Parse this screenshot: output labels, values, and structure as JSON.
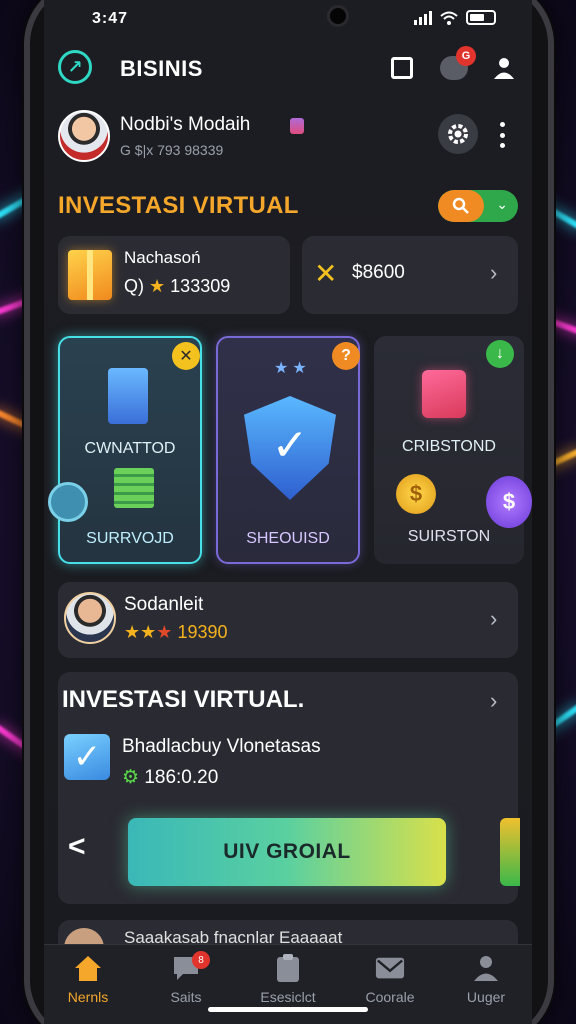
{
  "status_bar": {
    "time": "3:47"
  },
  "header": {
    "title": "BISINIS",
    "notification_count": "G"
  },
  "profile": {
    "name": "Nodbi's Modaih",
    "subtitle": "G $|x  793 98339"
  },
  "section1": {
    "title": "INVESTASI VIRTUAL"
  },
  "summary_cards": [
    {
      "title": "Nachasoń",
      "sub_prefix": "Q)",
      "value": "133309"
    },
    {
      "amount": "$8600"
    }
  ],
  "features": [
    {
      "label1": "CWNATTOD",
      "label2": "SURRVOJD",
      "badge": "✕",
      "badge_color": "#f4c21e"
    },
    {
      "label1": "",
      "label2": "SHEOUISD",
      "badge": "?",
      "badge_color": "#f08a22"
    },
    {
      "label1": "CRIBSTOND",
      "label2": "SUIRSTON",
      "badge": "↓",
      "badge_color": "#3ab84a"
    }
  ],
  "person": {
    "name": "Sodanleit",
    "rating": "19390"
  },
  "investment": {
    "title": "INVESTASI VIRTUAL.",
    "item_title": "Bhadlacbuy Vlonetasas",
    "item_value": "186:0.20",
    "cta_label": "UIV GROIAL"
  },
  "peek": {
    "text": "Saaakasab fnacnlar Eaaaaat"
  },
  "bottom_nav": [
    {
      "label": "Nernls",
      "icon": "home-icon"
    },
    {
      "label": "Saits",
      "icon": "chat-icon",
      "badge": "8"
    },
    {
      "label": "Esesiclct",
      "icon": "clipboard-icon"
    },
    {
      "label": "Coorale",
      "icon": "mail-icon"
    },
    {
      "label": "Uuger",
      "icon": "user-icon"
    }
  ],
  "colors": {
    "accent": "#f4a72a",
    "teal": "#2ed8c4",
    "card": "#2b2c33"
  }
}
